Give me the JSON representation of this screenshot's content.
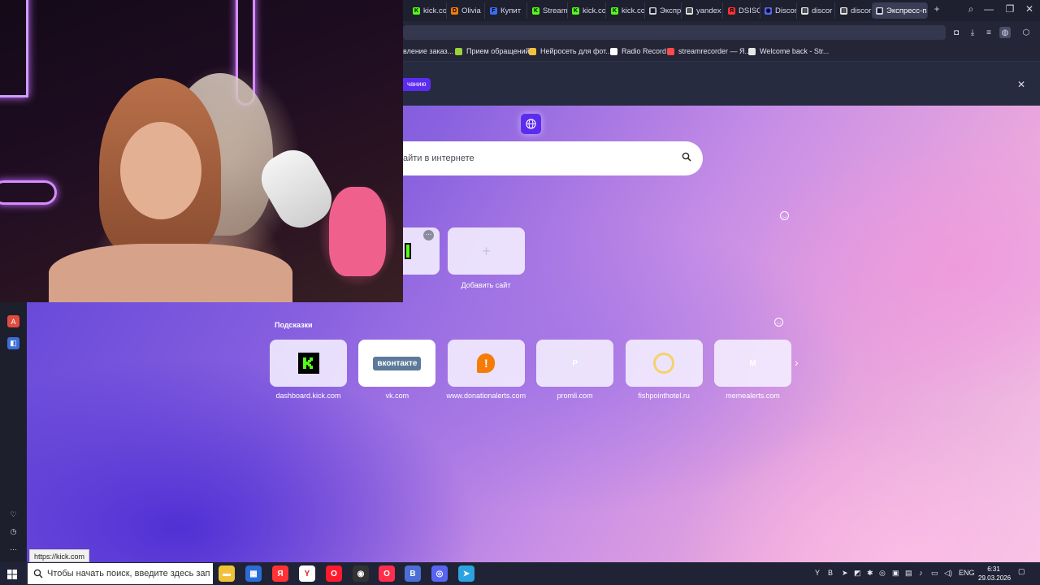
{
  "tabs": [
    {
      "label": "kick.co",
      "fav": "K",
      "color": "#53fc18"
    },
    {
      "label": "Olivia",
      "fav": "D",
      "color": "#f57d07"
    },
    {
      "label": "Купит",
      "fav": "F",
      "color": "#3a6cf4"
    },
    {
      "label": "Stream",
      "fav": "K",
      "color": "#53fc18"
    },
    {
      "label": "kick.co",
      "fav": "K",
      "color": "#53fc18"
    },
    {
      "label": "kick.co",
      "fav": "K",
      "color": "#53fc18"
    },
    {
      "label": "Экспр",
      "fav": "▦",
      "color": "#cfd2e6"
    },
    {
      "label": "yandex",
      "fav": "▤",
      "color": "#e6e6e6"
    },
    {
      "label": "DSISCO",
      "fav": "Я",
      "color": "#ff3333"
    },
    {
      "label": "Discor",
      "fav": "◉",
      "color": "#5865f2"
    },
    {
      "label": "discor",
      "fav": "▤",
      "color": "#e6e6e6"
    },
    {
      "label": "discor",
      "fav": "▤",
      "color": "#e6e6e6"
    },
    {
      "label": "Экспресс-па",
      "fav": "▦",
      "color": "#cfd2e6",
      "active": true
    }
  ],
  "window": {
    "new_tab": "+",
    "search": "⌕",
    "minimize": "—",
    "maximize": "❐",
    "close": "✕"
  },
  "bookmarks": [
    {
      "label": "вление заказ...",
      "color": "#888"
    },
    {
      "label": "Прием обращений",
      "color": "#9bd13a"
    },
    {
      "label": "Нейросеть для фот...",
      "color": "#f0c040"
    },
    {
      "label": "Radio Record",
      "color": "#ffffff"
    },
    {
      "label": "streamrecorder — Я...",
      "color": "#ff4b4b"
    },
    {
      "label": "Welcome back - Str...",
      "color": "#e6e6e6"
    }
  ],
  "banner": {
    "button_label": "чанию",
    "close": "✕"
  },
  "search": {
    "placeholder": "айти в интернете"
  },
  "speed_dial": {
    "add_label": "Добавить сайт",
    "add_symbol": "+"
  },
  "suggestions": {
    "title": "Подсказки",
    "items": [
      {
        "label": "dashboard.kick.com",
        "icon": "kick-icon"
      },
      {
        "label": "vk.com",
        "icon": "vk-logo",
        "logo_text": "вконтакте"
      },
      {
        "label": "www.donationalerts.com",
        "icon": "donationalerts-icon"
      },
      {
        "label": "promli.com",
        "icon": "letter-icon",
        "letter": "P"
      },
      {
        "label": "fishpointhotel.ru",
        "icon": "ring-icon"
      },
      {
        "label": "memealerts.com",
        "icon": "letter-icon",
        "letter": "M"
      }
    ],
    "next": "›"
  },
  "status_url": "https://kick.com",
  "taskbar": {
    "search_placeholder": "Чтобы начать поиск, введите здесь запрос",
    "apps": [
      {
        "name": "file-explorer-icon",
        "color": "#f0c23a",
        "glyph": "▬"
      },
      {
        "name": "store-icon",
        "color": "#2b6cd8",
        "glyph": "▦"
      },
      {
        "name": "yandex-icon",
        "color": "#ff3333",
        "glyph": "Я"
      },
      {
        "name": "yandex-browser-icon",
        "color": "#ffffff",
        "glyph": "Y"
      },
      {
        "name": "opera-icon",
        "color": "#ff1b2d",
        "glyph": "O"
      },
      {
        "name": "obs-icon",
        "color": "#333333",
        "glyph": "◉"
      },
      {
        "name": "opera-gx-icon",
        "color": "#ff2e4d",
        "glyph": "O"
      },
      {
        "name": "vk-icon",
        "color": "#4c6fd6",
        "glyph": "B"
      },
      {
        "name": "discord-icon",
        "color": "#5865f2",
        "glyph": "◎"
      },
      {
        "name": "telegram-icon",
        "color": "#2aa3e0",
        "glyph": "➤"
      }
    ],
    "lang": "ENG",
    "time": "6:31",
    "date": "29.03.2026"
  }
}
